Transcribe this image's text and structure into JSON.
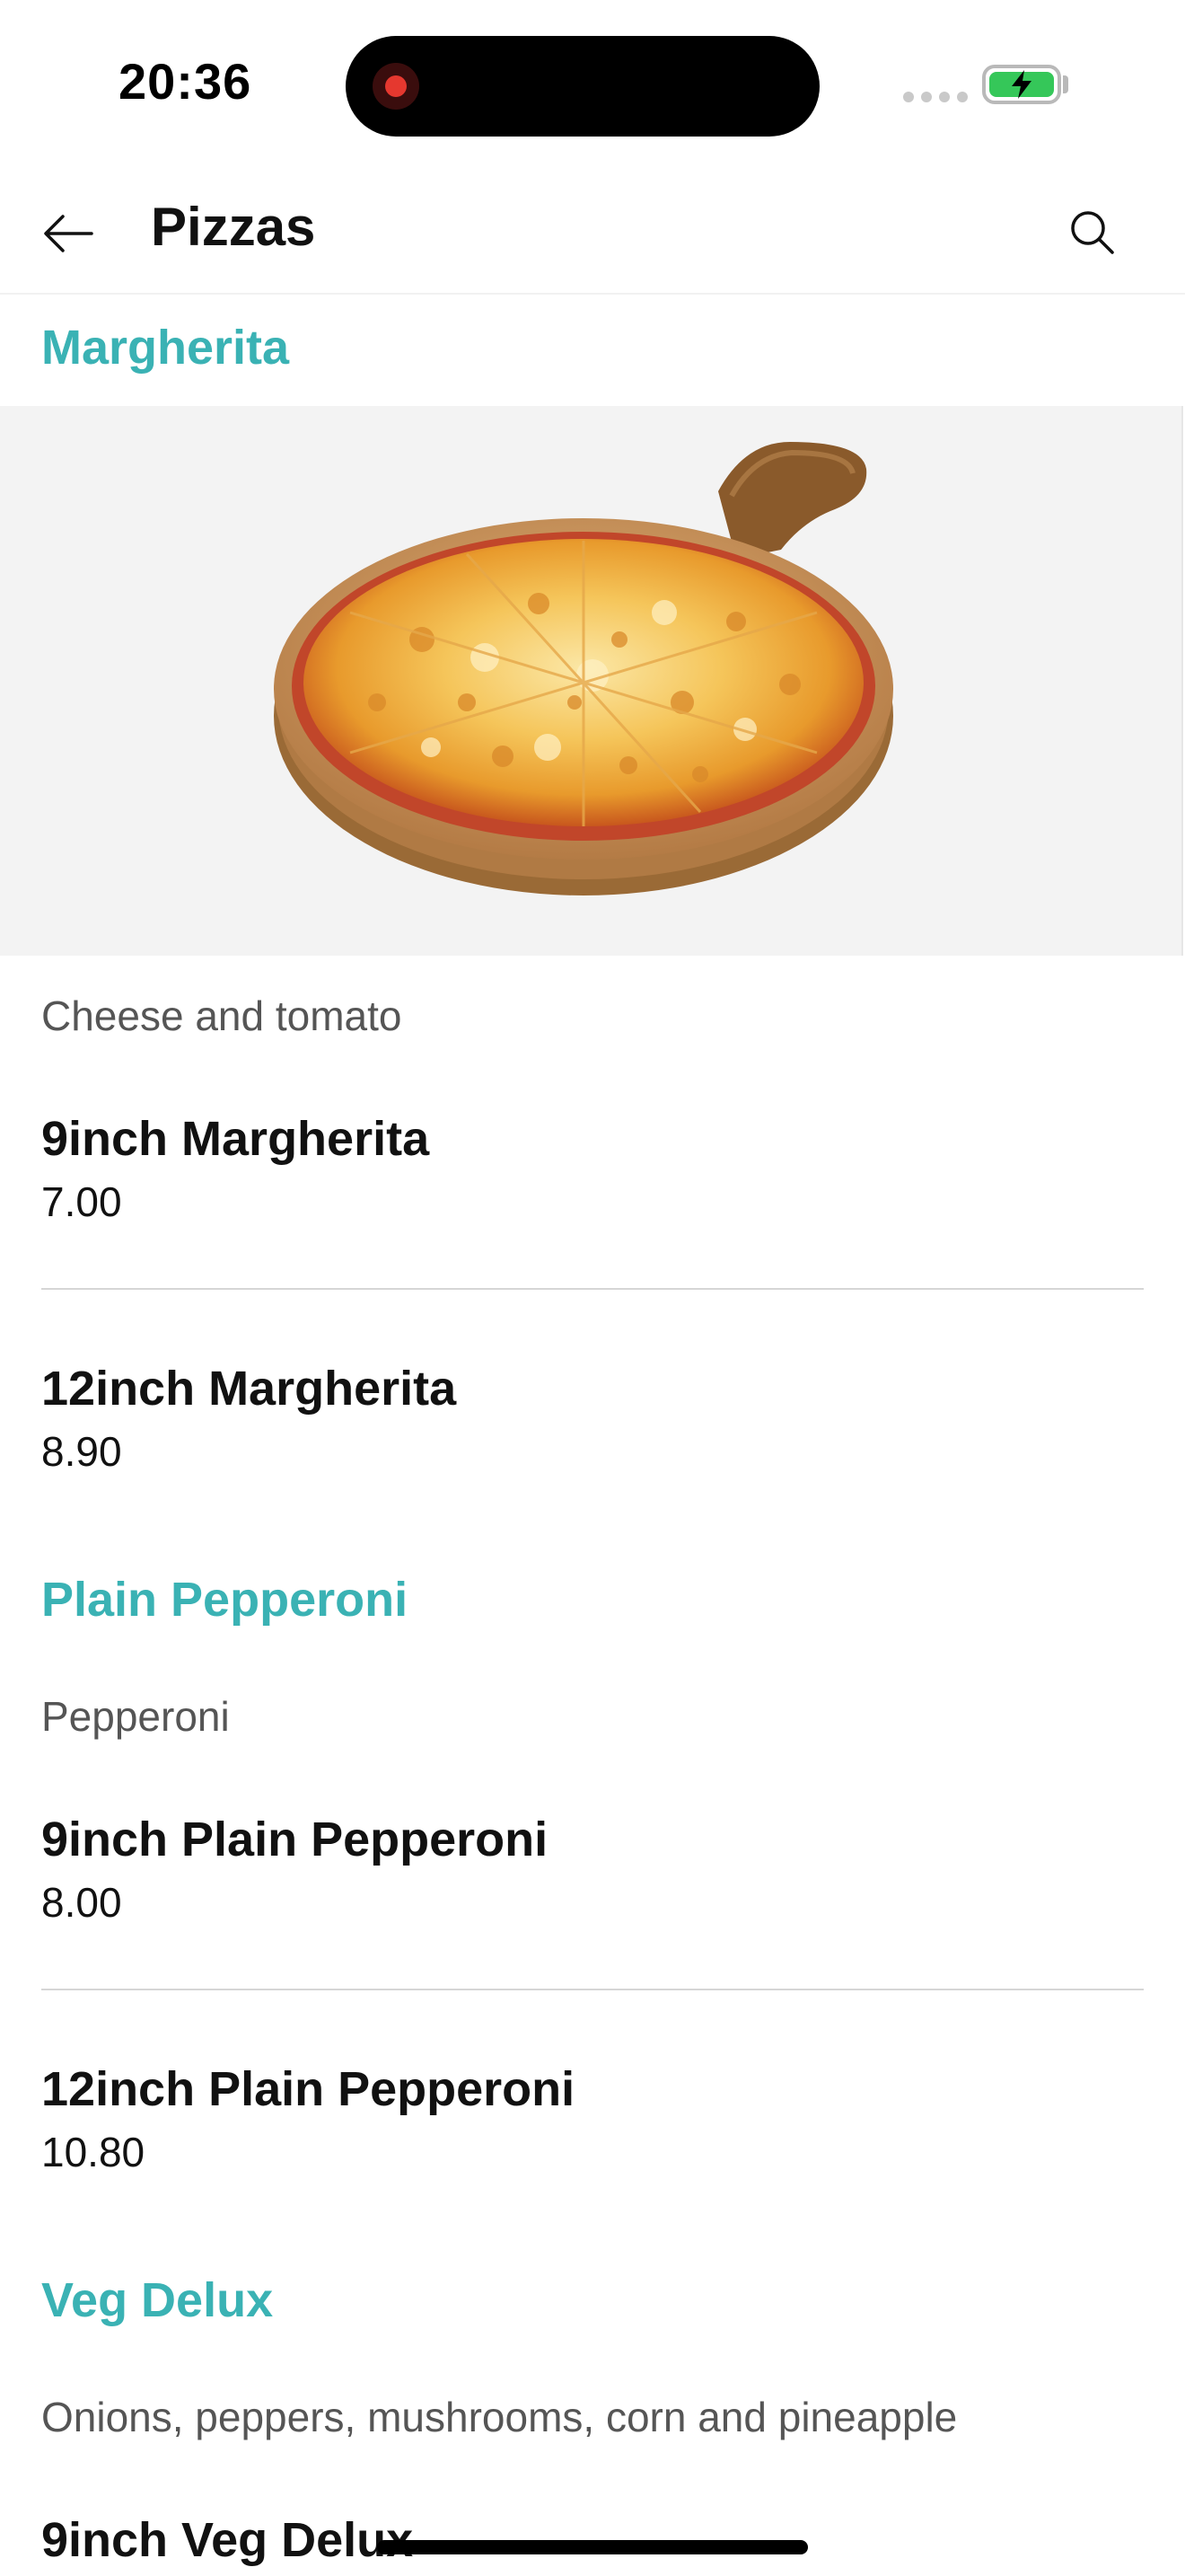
{
  "status_bar": {
    "time": "20:36"
  },
  "header": {
    "title": "Pizzas",
    "back_icon": "arrow-left-icon",
    "search_icon": "search-icon"
  },
  "colors": {
    "accent": "#3ab2b4",
    "battery": "#35c759",
    "recording": "#e5382f"
  },
  "sections": [
    {
      "title": "Margherita",
      "has_image": true,
      "image": "pizza-margherita-image",
      "description": "Cheese and tomato",
      "items": [
        {
          "name": "9inch Margherita",
          "price": "7.00"
        },
        {
          "name": "12inch Margherita",
          "price": "8.90"
        }
      ]
    },
    {
      "title": "Plain Pepperoni",
      "description": "Pepperoni",
      "items": [
        {
          "name": "9inch Plain Pepperoni",
          "price": "8.00"
        },
        {
          "name": "12inch Plain Pepperoni",
          "price": "10.80"
        }
      ]
    },
    {
      "title": "Veg Delux",
      "description": "Onions, peppers, mushrooms, corn and pineapple",
      "items": [
        {
          "name": "9inch Veg Delux"
        }
      ]
    }
  ]
}
